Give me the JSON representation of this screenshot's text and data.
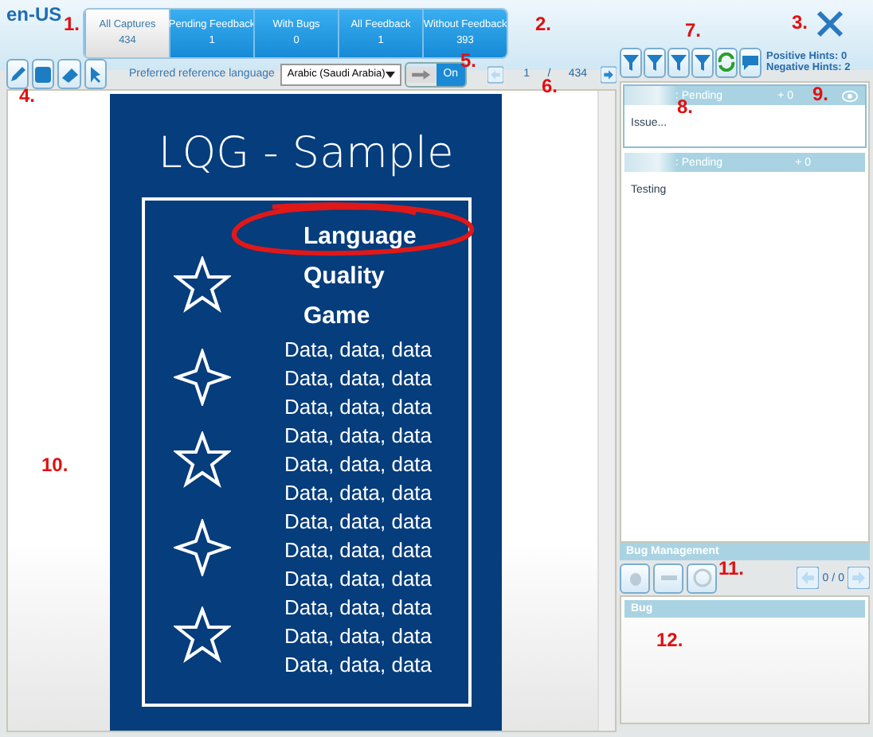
{
  "locale": "en-US",
  "tabs": [
    {
      "label": "All Captures",
      "count": "434",
      "selected": true
    },
    {
      "label": "Pending Feedback",
      "count": "1",
      "selected": false
    },
    {
      "label": "With Bugs",
      "count": "0",
      "selected": false
    },
    {
      "label": "All Feedback",
      "count": "1",
      "selected": false
    },
    {
      "label": "Without Feedback",
      "count": "393",
      "selected": false
    }
  ],
  "reference_language": {
    "label": "Preferred reference language",
    "value": "Arabic (Saudi Arabia)",
    "toggle": {
      "label": "On",
      "on": true
    }
  },
  "pager": {
    "current": "1",
    "separator": "/",
    "total": "434"
  },
  "sample": {
    "title": "LQG - Sample",
    "headline": [
      "Language",
      "Quality",
      "Game"
    ],
    "lines": [
      "Data, data, data",
      "Data, data, data",
      "Data, data, data",
      "Data, data, data",
      "Data, data, data",
      "Data, data, data",
      "Data, data, data",
      "Data, data, data",
      "Data, data, data",
      "Data, data, data",
      "Data, data, data",
      "Data, data, data"
    ]
  },
  "hints": {
    "positive": "Positive Hints: 0",
    "negative": "Negative Hints: 2"
  },
  "feedback": [
    {
      "status": ": Pending",
      "score": "+ 0",
      "body": "Issue...",
      "selected": true
    },
    {
      "status": ": Pending",
      "score": "+ 0",
      "body": "Testing",
      "selected": false
    }
  ],
  "bug_management": {
    "title": "Bug Management",
    "pager": {
      "current": "0",
      "separator": "/",
      "total": "0"
    },
    "section": "Bug"
  },
  "annotations": [
    "1.",
    "2.",
    "3.",
    "4.",
    "5.",
    "6.",
    "7.",
    "8.",
    "9.",
    "10.",
    "11.",
    "12."
  ]
}
